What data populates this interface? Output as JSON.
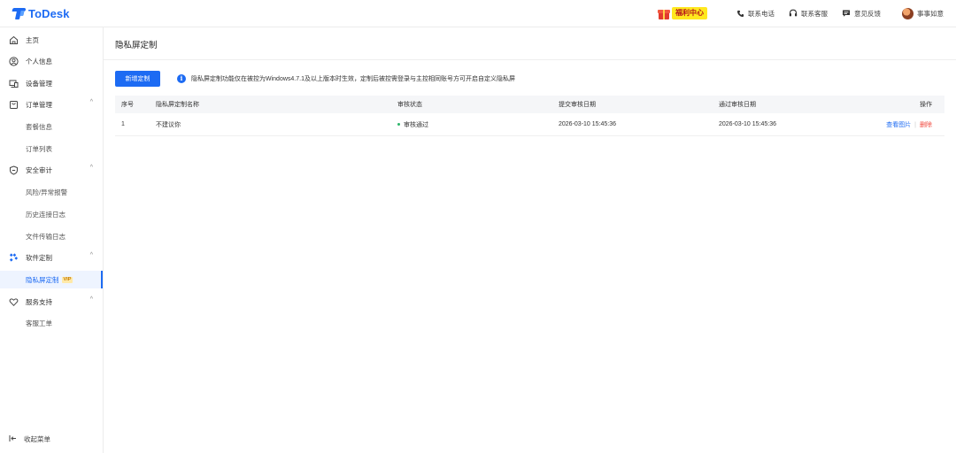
{
  "header": {
    "logo_text": "ToDesk",
    "promo_label": "福利中心",
    "links": [
      {
        "label": "联系电话",
        "icon": "phone-icon"
      },
      {
        "label": "联系客服",
        "icon": "headset-icon"
      },
      {
        "label": "意见反馈",
        "icon": "feedback-icon"
      }
    ],
    "user_name": "事事如意"
  },
  "sidebar": {
    "items": [
      {
        "label": "主页",
        "icon": "home-icon"
      },
      {
        "label": "个人信息",
        "icon": "user-circle-icon"
      },
      {
        "label": "设备管理",
        "icon": "device-icon"
      },
      {
        "label": "订单管理",
        "icon": "order-icon"
      },
      {
        "label": "安全审计",
        "icon": "shield-icon"
      },
      {
        "label": "软件定制",
        "icon": "puzzle-icon"
      },
      {
        "label": "服务支持",
        "icon": "heart-icon"
      }
    ],
    "order_sub": [
      "套餐信息",
      "订单列表"
    ],
    "audit_sub": [
      "风险/异常报警",
      "历史连接日志",
      "文件传输日志"
    ],
    "custom_sub": [
      "隐私屏定制"
    ],
    "vip_badge": "VIP",
    "support_sub": [
      "客服工单"
    ],
    "collapse_label": "收起菜单"
  },
  "main": {
    "page_title": "隐私屏定制",
    "new_button": "新增定制",
    "notice": "隐私屏定制功能仅在被控为Windows4.7.1及以上版本时生效，定制后被控需登录与主控相同账号方可开启自定义隐私屏",
    "table": {
      "headers": [
        "序号",
        "隐私屏定制名称",
        "审核状态",
        "提交审核日期",
        "通过审核日期",
        "操作"
      ],
      "rows": [
        {
          "index": "1",
          "name": "不建议你",
          "status": "审核通过",
          "submit_date": "2026-03-10 15:45:36",
          "pass_date": "2026-03-10 15:45:36",
          "action_view": "查看图片",
          "action_sep": "|",
          "action_delete": "删除"
        }
      ]
    }
  },
  "colors": {
    "brand": "#1d6bf3",
    "success": "#2db56a",
    "danger": "#f0463b",
    "promo_bg": "#ffe81f"
  }
}
